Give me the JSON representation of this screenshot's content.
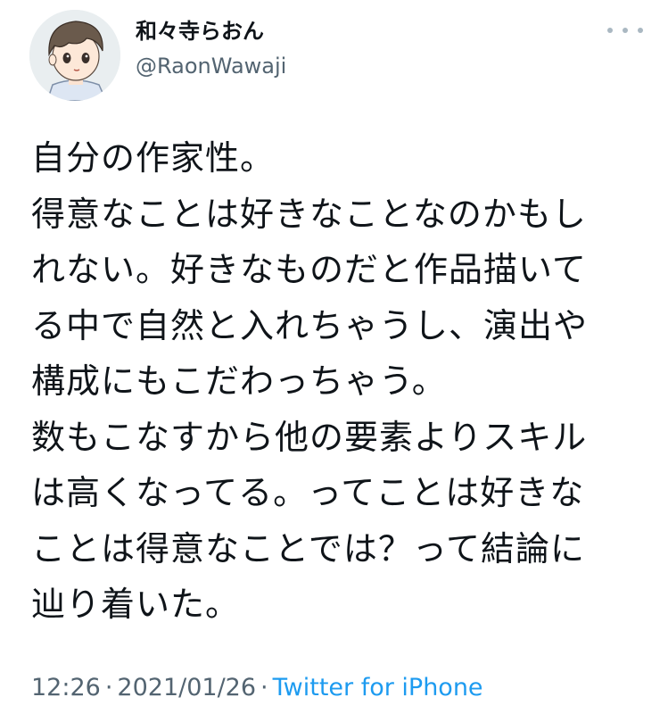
{
  "user": {
    "display_name": "和々寺らおん",
    "handle": "@RaonWawaji",
    "avatar_icon": "avatar-illustration"
  },
  "more_icon": "more-horizontal-icon",
  "tweet": {
    "lines": [
      "自分の作家性。",
      "得意なことは好きなことなのかもし",
      "れない。好きなものだと作品描いて",
      "る中で自然と入れちゃうし、演出や",
      "構成にもこだわっちゃう。",
      "数もこなすから他の要素よりスキル",
      "は高くなってる。ってことは好きな",
      "ことは得意なことでは？って結論に",
      "辿り着いた。"
    ]
  },
  "meta": {
    "time": "12:26",
    "separator": "·",
    "date": "2021/01/26",
    "source": "Twitter for iPhone"
  },
  "colors": {
    "text": "#0f1419",
    "secondary": "#536471",
    "link": "#1d9bf0"
  }
}
